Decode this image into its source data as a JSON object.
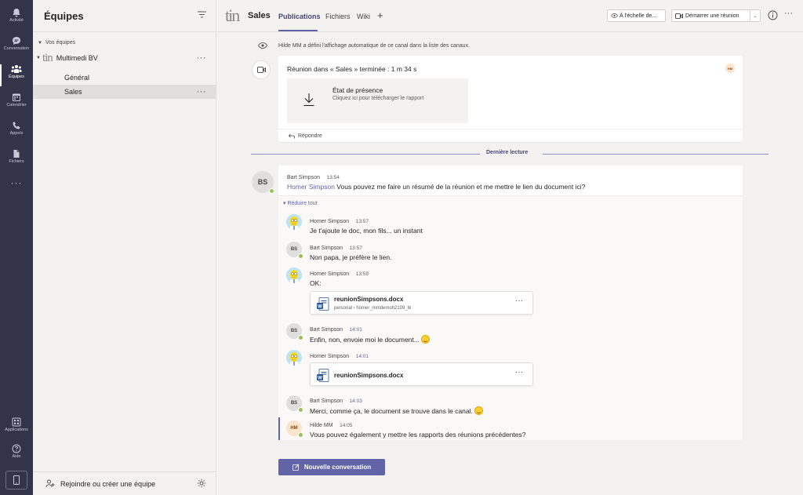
{
  "rail": {
    "items": [
      {
        "label": "Activité",
        "icon": "bell-icon"
      },
      {
        "label": "Conversation",
        "icon": "chat-icon"
      },
      {
        "label": "Équipes",
        "icon": "teams-icon"
      },
      {
        "label": "Calendrier",
        "icon": "calendar-icon"
      },
      {
        "label": "Appels",
        "icon": "phone-icon"
      },
      {
        "label": "Fichiers",
        "icon": "file-icon"
      }
    ],
    "more": "···",
    "bottom": [
      {
        "label": "Applications",
        "icon": "apps-icon"
      },
      {
        "label": "Aide",
        "icon": "help-icon"
      }
    ]
  },
  "teams_panel": {
    "title": "Équipes",
    "section": "Vos équipes",
    "team": {
      "logo": "tin",
      "name": "Multimedi BV",
      "more": "···"
    },
    "channels": [
      "Général",
      "Sales"
    ],
    "channel_more": "···",
    "footer": "Rejoindre ou créer une équipe"
  },
  "header": {
    "logo": "tin",
    "channel": "Sales",
    "tabs": [
      "Publications",
      "Fichiers",
      "Wiki"
    ],
    "add_tab": "+",
    "scale_label": "À l'échelle de...",
    "meet_label": "Démarrer une réunion"
  },
  "feed": {
    "notice": "Hilde MM a défini l'affichage automatique de ce canal dans la liste des canaux.",
    "meeting": {
      "title": "Réunion dans « Sales » terminée : 1 m 34 s",
      "avatar": "HM",
      "attendance_title": "État de présence",
      "attendance_sub": "Cliquez ici pour télécharger le rapport",
      "reply": "Répondre"
    },
    "last_read": "Dernière lecture",
    "thread": {
      "root": {
        "initials": "BS",
        "sender": "Bart Simpson",
        "time": "13:54",
        "mention": "Homer Simpson",
        "text": " Vous pouvez me faire un résumé de la réunion et me mettre le lien du document ici?"
      },
      "collapse": "Réduire tout",
      "replies": [
        {
          "sender": "Homer Simpson",
          "time": "13:57",
          "text": "Je t'ajoute le doc, mon fils... un instant"
        },
        {
          "initials": "BS",
          "sender": "Bart Simpson",
          "time": "13:57",
          "text": "Non papa, je préfère le lien."
        },
        {
          "sender": "Homer Simpson",
          "time": "13:59",
          "text": "OK:"
        },
        {
          "initials": "BS",
          "sender": "Bart Simpson",
          "time": "14:01",
          "text": "Enfin, non, envoie moi le document..."
        },
        {
          "sender": "Homer Simpson",
          "time": "14:01",
          "text": ""
        },
        {
          "initials": "BS",
          "sender": "Bart Simpson",
          "time": "14:03",
          "text": "Merci, comme ça, le document se trouve dans le canal."
        },
        {
          "initials": "HM",
          "sender": "Hilde MM",
          "time": "14:05",
          "text": "Vous pouvez également y mettre les rapports des réunions précédentes?"
        }
      ],
      "files": [
        {
          "name": "reunionSimpsons.docx",
          "path_a": "personal",
          "path_b": "homer_mmdemoh2109_tk",
          "more": "···"
        },
        {
          "name": "reunionSimpsons.docx",
          "more": "···"
        }
      ]
    }
  },
  "new_conversation": "Nouvelle conversation",
  "colors": {
    "rail": "#33344a",
    "accent": "#6264a7",
    "presence": "#92c353"
  }
}
